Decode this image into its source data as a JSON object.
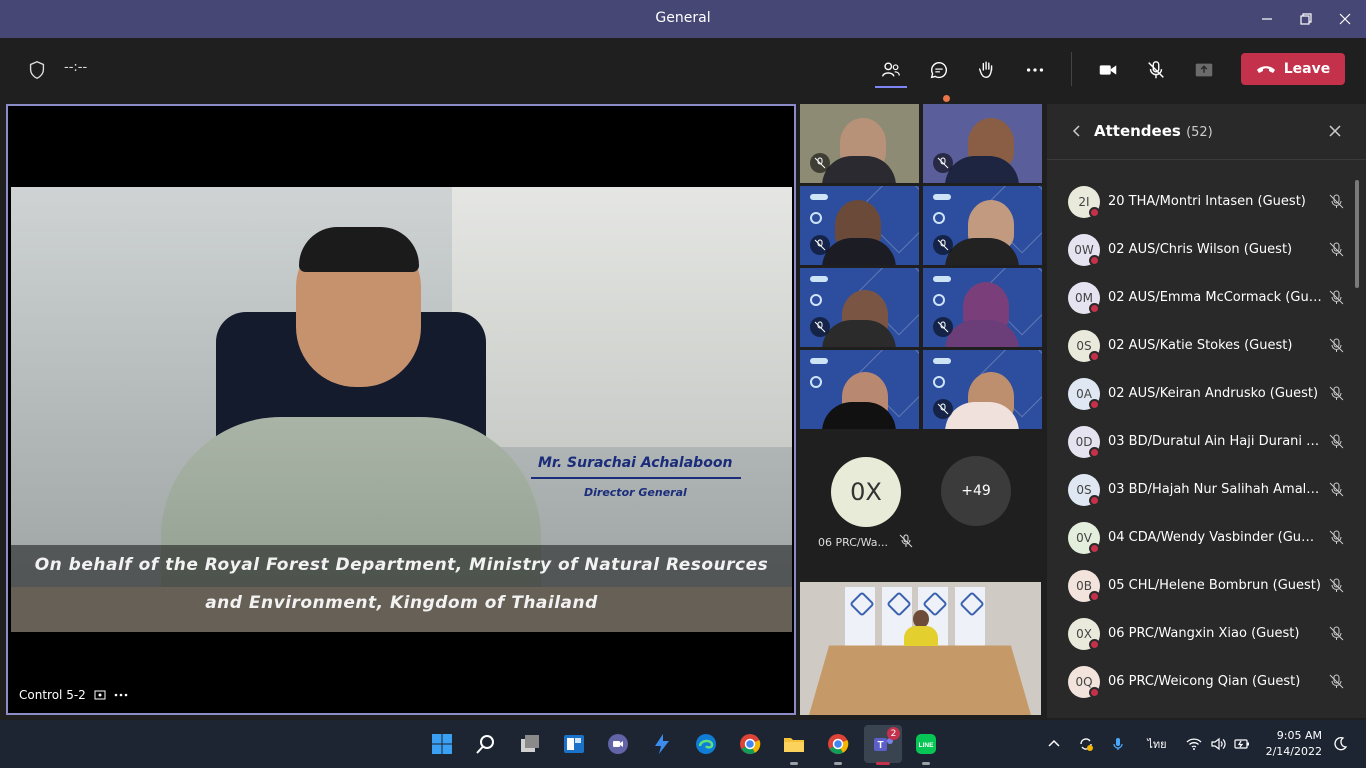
{
  "window": {
    "title": "General"
  },
  "toolbar": {
    "timer": "--:--",
    "leave_label": "Leave",
    "colors": {
      "leave": "#c4314b",
      "titlebar": "#464775",
      "accent": "#7f85f5"
    }
  },
  "stage": {
    "presenter_name": "Mr. Surachai Achalaboon",
    "presenter_role": "Director General",
    "caption_line1": "On behalf of the Royal Forest Department, Ministry of Natural Resources",
    "caption_line2": "and Environment, Kingdom of Thailand",
    "label": "Control 5-2"
  },
  "gallery": {
    "avatar_initials": "0X",
    "avatar_name": "06 PRC/Wa...",
    "more_count": "+49"
  },
  "panel": {
    "title": "Attendees",
    "count": "(52)",
    "attendees": [
      {
        "initials": "2I",
        "name": "20 THA/Montri Intasen (Guest)"
      },
      {
        "initials": "0W",
        "name": "02 AUS/Chris Wilson (Guest)"
      },
      {
        "initials": "0M",
        "name": "02 AUS/Emma McCormack (Gue..."
      },
      {
        "initials": "0S",
        "name": "02 AUS/Katie Stokes (Guest)"
      },
      {
        "initials": "0A",
        "name": "02 AUS/Keiran Andrusko (Guest)"
      },
      {
        "initials": "0D",
        "name": "03 BD/Duratul Ain Haji Durani (..."
      },
      {
        "initials": "0S",
        "name": "03 BD/Hajah Nur Salihah Amalin..."
      },
      {
        "initials": "0V",
        "name": "04 CDA/Wendy Vasbinder (Guest)"
      },
      {
        "initials": "0B",
        "name": "05 CHL/Helene Bombrun (Guest)"
      },
      {
        "initials": "0X",
        "name": "06 PRC/Wangxin Xiao (Guest)"
      },
      {
        "initials": "0Q",
        "name": "06 PRC/Weicong Qian (Guest)"
      }
    ]
  },
  "taskbar": {
    "teams_badge": "2",
    "line_label": "LINE",
    "language": "ไทย",
    "time": "9:05 AM",
    "date": "2/14/2022"
  }
}
